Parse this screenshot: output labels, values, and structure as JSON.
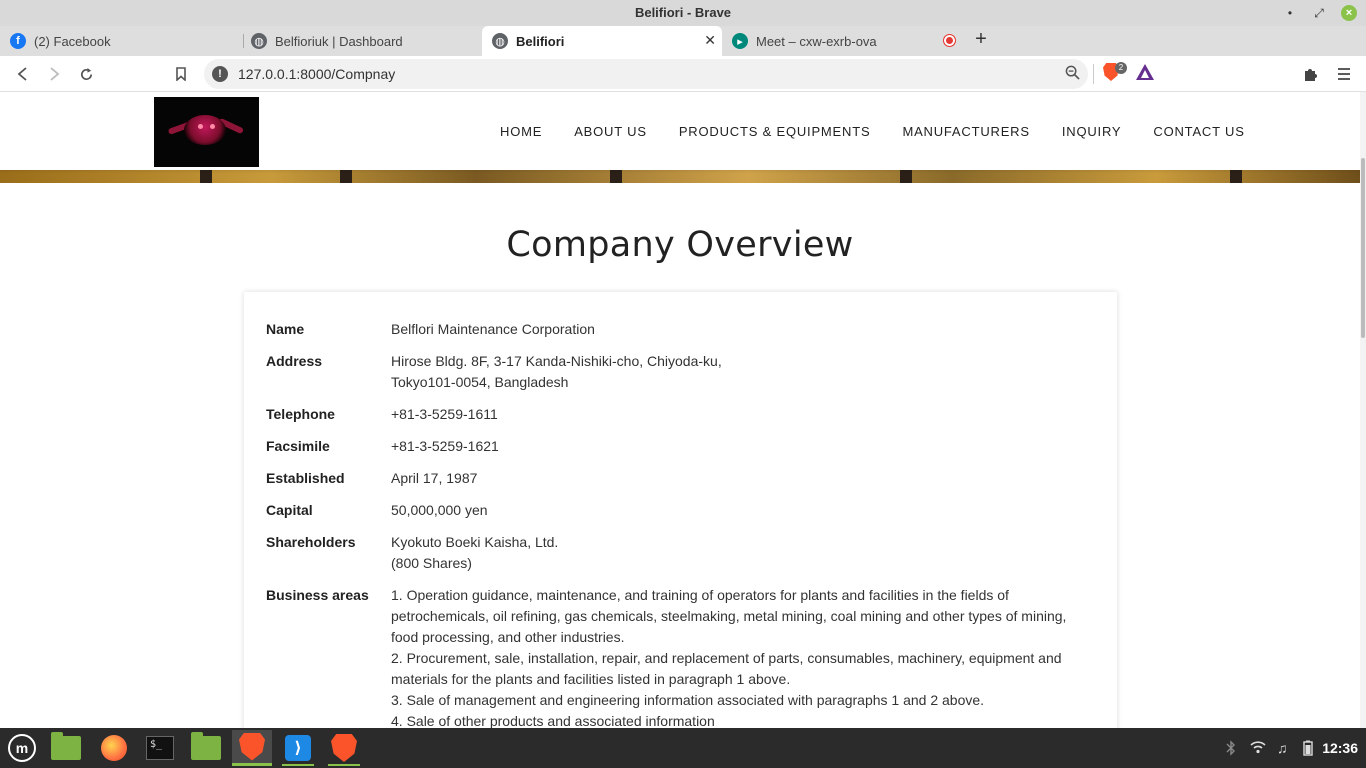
{
  "window": {
    "title": "Belifiori - Brave",
    "minimize": "•",
    "restore": "⤢",
    "close": "×"
  },
  "tabs": [
    {
      "label": "(2) Facebook",
      "favicon": "facebook-icon",
      "favicon_color": "#1877f2"
    },
    {
      "label": "Belfioriuk | Dashboard",
      "favicon": "globe-icon",
      "favicon_color": "#5f6368"
    },
    {
      "label": "Belifiori",
      "favicon": "globe-icon",
      "favicon_color": "#5f6368",
      "active": true
    },
    {
      "label": "Meet – cxw-exrb-ova",
      "favicon": "google-meet-icon",
      "favicon_color": "#00897b"
    }
  ],
  "toolbar": {
    "url": "127.0.0.1:8000/Compnay",
    "shield_count": "2",
    "back_icon": "back-arrow-icon",
    "forward_icon": "forward-arrow-icon",
    "reload_icon": "reload-icon",
    "bookmark_icon": "bookmark-icon",
    "extensions_icon": "puzzle-icon",
    "menu_icon": "hamburger-menu-icon"
  },
  "site": {
    "nav": [
      "HOME",
      "ABOUT US",
      "PRODUCTS & EQUIPMENTS",
      "MANUFACTURERS",
      "INQUIRY",
      "CONTACT US"
    ],
    "page_title": "Company Overview"
  },
  "company": {
    "name_label": "Name",
    "name": "Belflori Maintenance Corporation",
    "address_label": "Address",
    "address_line1": "Hirose Bldg. 8F, 3-17 Kanda-Nishiki-cho, Chiyoda-ku,",
    "address_line2": "Tokyo101-0054, Bangladesh",
    "telephone_label": "Telephone",
    "telephone": "+81-3-5259-1611",
    "facsimile_label": "Facsimile",
    "facsimile": "+81-3-5259-1621",
    "established_label": "Established",
    "established": "April 17, 1987",
    "capital_label": "Capital",
    "capital": "50,000,000 yen",
    "shareholders_label": "Shareholders",
    "shareholders_line1": "Kyokuto Boeki Kaisha, Ltd.",
    "shareholders_line2": "(800 Shares)",
    "business_label": "Business areas",
    "business_lines": [
      "1. Operation guidance, maintenance, and training of operators for plants and facilities in the fields of",
      "petrochemicals, oil refining, gas chemicals, steelmaking, metal mining, coal mining and other types of mining,",
      "food processing, and other industries.",
      "2. Procurement, sale, installation, repair, and replacement of parts, consumables, machinery, equipment and",
      "materials for the plants and facilities listed in paragraph 1 above.",
      "3. Sale of management and engineering information associated with paragraphs 1 and 2 above.",
      "4. Sale of other products and associated information"
    ]
  },
  "taskbar": {
    "clock": "12:36",
    "menu_glyph": "m",
    "terminal_glyph": "$_",
    "vscode_glyph": "⟩"
  },
  "colors": {
    "accent": "#8bc34a",
    "brave": "#fb542b",
    "facebook": "#1877f2"
  }
}
